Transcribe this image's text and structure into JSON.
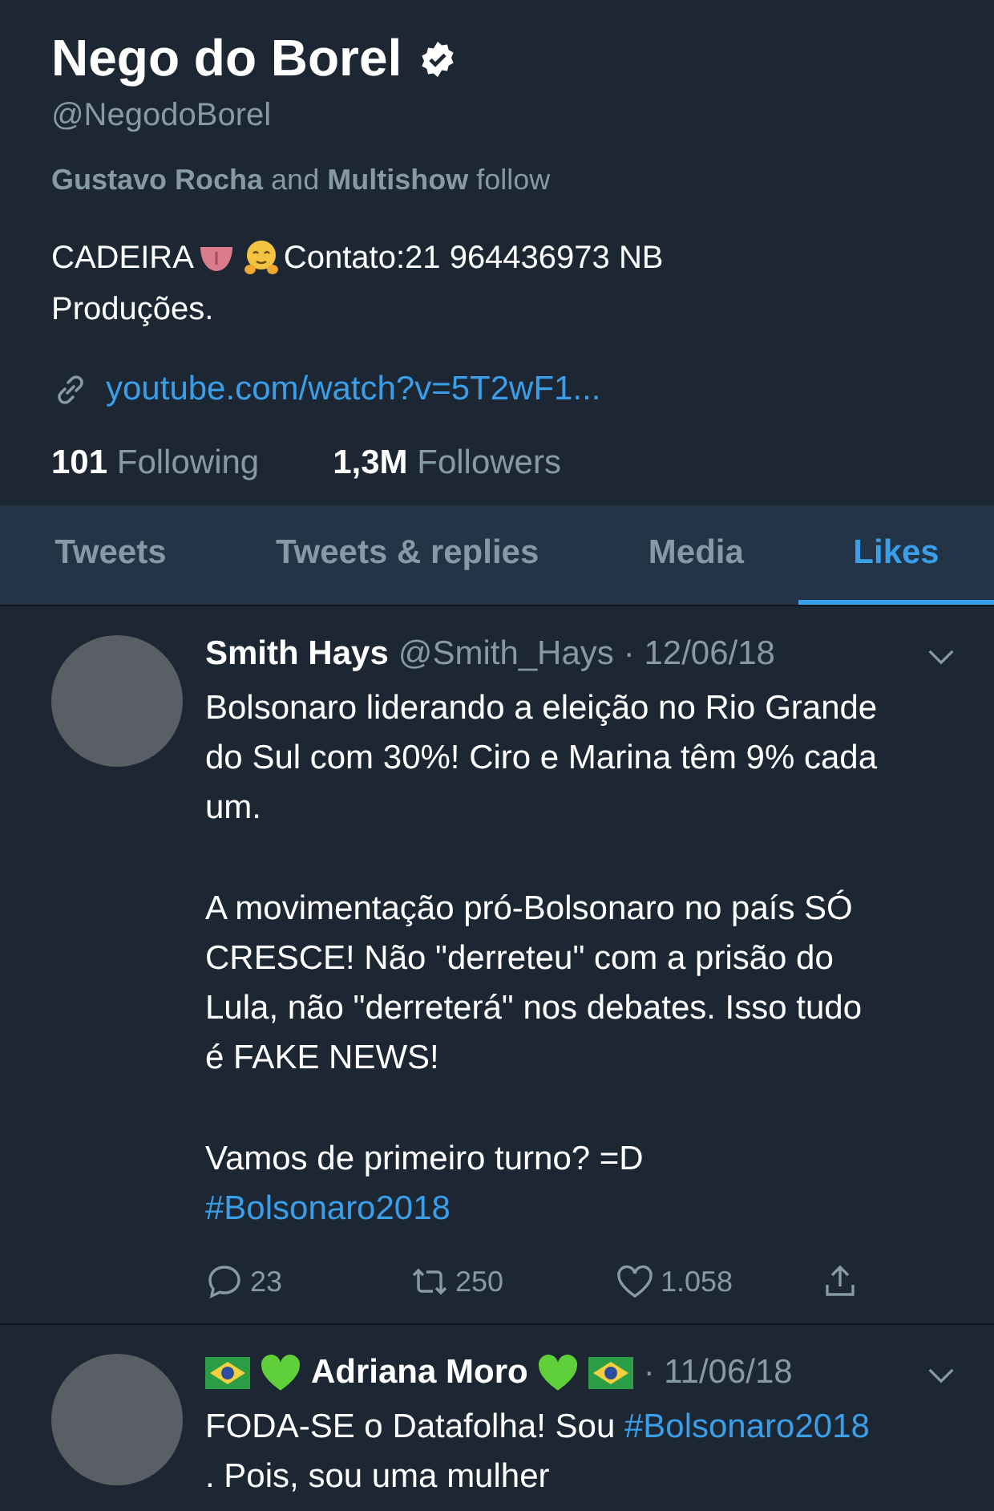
{
  "profile": {
    "name": "Nego do Borel",
    "verified": true,
    "handle": "@NegodoBorel",
    "followed_by": [
      {
        "text": "Gustavo Rocha",
        "kind": "name"
      },
      {
        "text": "and",
        "kind": "plain"
      },
      {
        "text": "Multishow",
        "kind": "name"
      },
      {
        "text": "follow",
        "kind": "plain"
      }
    ],
    "bio_start": "CADEIRA",
    "bio_end": "Contato:21 964436973 NB",
    "bio_cont": "Produções.",
    "link": "youtube.com/watch?v=5T2wF1...",
    "stats": [
      {
        "count": "101",
        "label": "Following"
      },
      {
        "count": "1,3M",
        "label": "Followers"
      }
    ]
  },
  "tabs": [
    {
      "label": "Tweets",
      "selected": false
    },
    {
      "label": "Tweets & replies",
      "selected": false
    },
    {
      "label": "Media",
      "selected": false
    },
    {
      "label": "Likes",
      "selected": true
    }
  ],
  "tweets": [
    {
      "name": "Smith Hays",
      "flags": false,
      "handle": "@Smith_Hays",
      "date": "· 12/06/18",
      "paragraphs": [
        [
          {
            "kind": "text",
            "text": "Bolsonaro liderando a eleição no Rio Grande do Sul com 30%! Ciro e Marina têm 9% cada um."
          }
        ],
        [
          {
            "kind": "text",
            "text": "A movimentação pró-Bolsonaro no país SÓ CRESCE! Não \"derreteu\" com a prisão do Lula, não \"derreterá\" nos debates. Isso tudo é FAKE NEWS!"
          }
        ],
        [
          {
            "kind": "text",
            "text": "Vamos de primeiro turno? =D"
          },
          {
            "kind": "hashtag",
            "text": "#Bolsonaro2018"
          }
        ]
      ],
      "replies": "23",
      "retweets": "250",
      "likes": "1.058"
    },
    {
      "name": "Adriana Moro",
      "flags": true,
      "date": "· 11/06/18",
      "paragraphs": [
        [
          {
            "kind": "text",
            "text": "FODA-SE o Datafolha! Sou"
          },
          {
            "kind": "hashtag",
            "text": "#Bolsonaro2018"
          },
          {
            "kind": "text",
            "text": ". Pois, sou uma mulher"
          }
        ]
      ]
    }
  ]
}
